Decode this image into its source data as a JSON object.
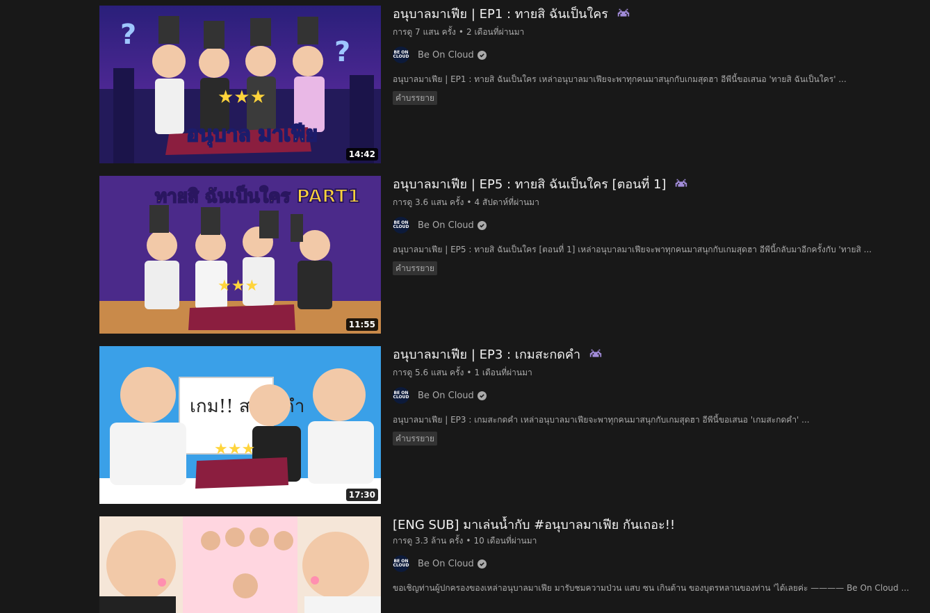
{
  "videos": [
    {
      "title": "อนุบาลมาเฟีย | EP1 : ทายสิ ฉันเป็นใคร",
      "views": "การดู 7 แสน ครั้ง",
      "age": "2 เดือนที่ผ่านมา",
      "channel": "Be On Cloud",
      "description": "อนุบาลมาเฟีย | EP1 : ทายสิ ฉันเป็นใคร เหล่าอนุบาลมาเฟียจะพาทุกคนมาสนุกกับเกมสุดฮา อีพีนี้ขอเสนอ 'ทายสิ ฉันเป็นใคร' ...",
      "badge": "คำบรรยาย",
      "duration": "14:42",
      "thumb_caption": "อนุบาล มาเฟีย"
    },
    {
      "title": "อนุบาลมาเฟีย | EP5 : ทายสิ ฉันเป็นใคร [ตอนที่ 1]",
      "views": "การดู 3.6 แสน ครั้ง",
      "age": "4 สัปดาห์ที่ผ่านมา",
      "channel": "Be On Cloud",
      "description": "อนุบาลมาเฟีย | EP5 : ทายสิ ฉันเป็นใคร [ตอนที่ 1] เหล่าอนุบาลมาเฟียจะพาทุกคนมาสนุกกับเกมสุดฮา อีพีนี้กลับมาอีกครั้งกับ 'ทายสิ ...",
      "badge": "คำบรรยาย",
      "duration": "11:55",
      "thumb_caption": "ทายสิ ฉันเป็นใคร PART1"
    },
    {
      "title": "อนุบาลมาเฟีย | EP3 : เกมสะกดคำ",
      "views": "การดู 5.6 แสน ครั้ง",
      "age": "1 เดือนที่ผ่านมา",
      "channel": "Be On Cloud",
      "description": "อนุบาลมาเฟีย | EP3 : เกมสะกดคำ เหล่าอนุบาลมาเฟียจะพาทุกคนมาสนุกกับเกมสุดฮา อีพีนี้ขอเสนอ 'เกมสะกดคำ' ...",
      "badge": "คำบรรยาย",
      "duration": "17:30",
      "thumb_caption": "เกม!! สะกดคำ"
    },
    {
      "title": "[ENG SUB] มาเล่นน้ำกับ #อนุบาลมาเฟีย กันเถอะ!!",
      "views": "การดู 3.3 ล้าน ครั้ง",
      "age": "10 เดือนที่ผ่านมา",
      "channel": "Be On Cloud",
      "description": "ขอเชิญท่านผู้ปกครองของเหล่าอนุบาลมาเฟีย มารับชมความป่วน แสบ ซน เกินต้าน ของบุตรหลานของท่าน 'ได้เลยค่ะ ———— Be On Cloud ...",
      "badge": "",
      "duration": "",
      "thumb_caption": ""
    }
  ],
  "avatar_text": "BE ON CLOUD",
  "colors": {
    "background": "#181818",
    "title": "#f1f1f1",
    "secondary": "#aaaaaa",
    "thumb1": "#3b2d8f",
    "thumb2": "#4b2a8a",
    "thumb3": "#3aa0e8",
    "thumb4": "#f5e6d8"
  },
  "icons": [
    "space-invader-icon",
    "verified-check-icon"
  ]
}
